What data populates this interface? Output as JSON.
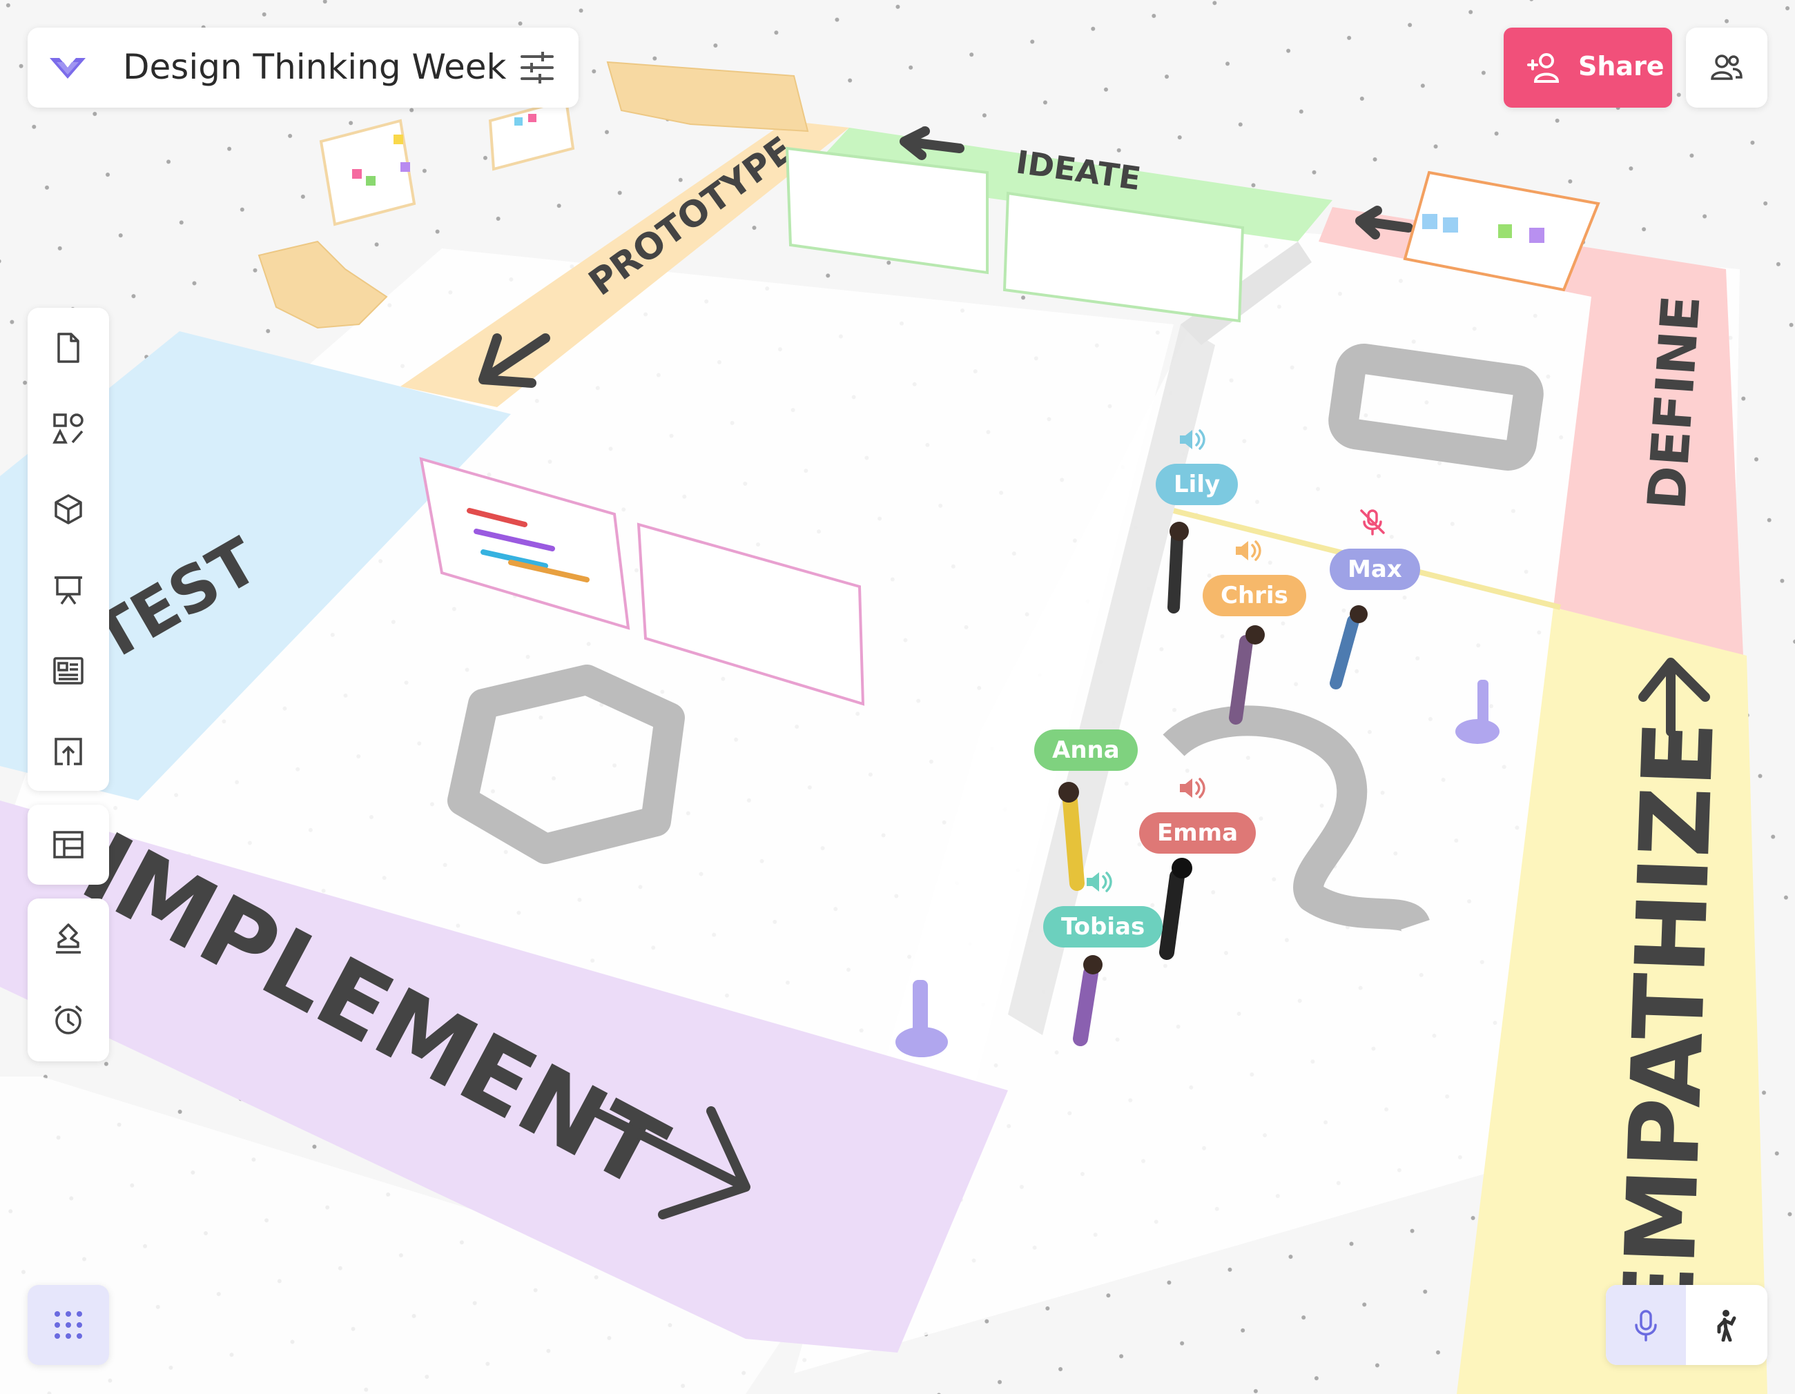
{
  "board": {
    "title": "Design Thinking Week",
    "logo_icon": "double-chevron-logo-icon",
    "settings_icon": "sliders-icon"
  },
  "header": {
    "share_label": "Share",
    "share_icon": "add-person-icon",
    "share_color": "#f1507a",
    "people_icon": "people-icon"
  },
  "toolbar": {
    "tools": [
      "page-icon",
      "shapes-icon",
      "cube-icon",
      "presentation-icon",
      "card-icon",
      "upload-icon"
    ],
    "layout_tool": "layout-icon",
    "extra_tools": [
      "stamp-icon",
      "timer-icon"
    ]
  },
  "bottom": {
    "apps_icon": "grid-dots-icon",
    "mic_icon": "microphone-icon",
    "walk_icon": "walking-person-icon"
  },
  "zones": {
    "ideate": "IDEATE",
    "prototype": "PROTOTYPE",
    "test": "TEST",
    "define": "DEFINE",
    "implement": "IMPLEMENT",
    "empathize": "EMPATHIZE"
  },
  "zone_colors": {
    "ideate": "#c8f5c0",
    "prototype": "#fde4b8",
    "test": "#d7eefb",
    "define": "#fdd0d0",
    "implement": "#ecdcf8",
    "empathize": "#fdf5bd"
  },
  "avatars": [
    {
      "name": "Lily",
      "color": "#7cc9e0",
      "status": "speaking"
    },
    {
      "name": "Chris",
      "color": "#f6b86a",
      "status": "speaking"
    },
    {
      "name": "Max",
      "color": "#9ea2e6",
      "status": "muted"
    },
    {
      "name": "Anna",
      "color": "#7fd27f",
      "status": "idle"
    },
    {
      "name": "Emma",
      "color": "#de7876",
      "status": "speaking"
    },
    {
      "name": "Tobias",
      "color": "#6cd0be",
      "status": "speaking"
    }
  ]
}
